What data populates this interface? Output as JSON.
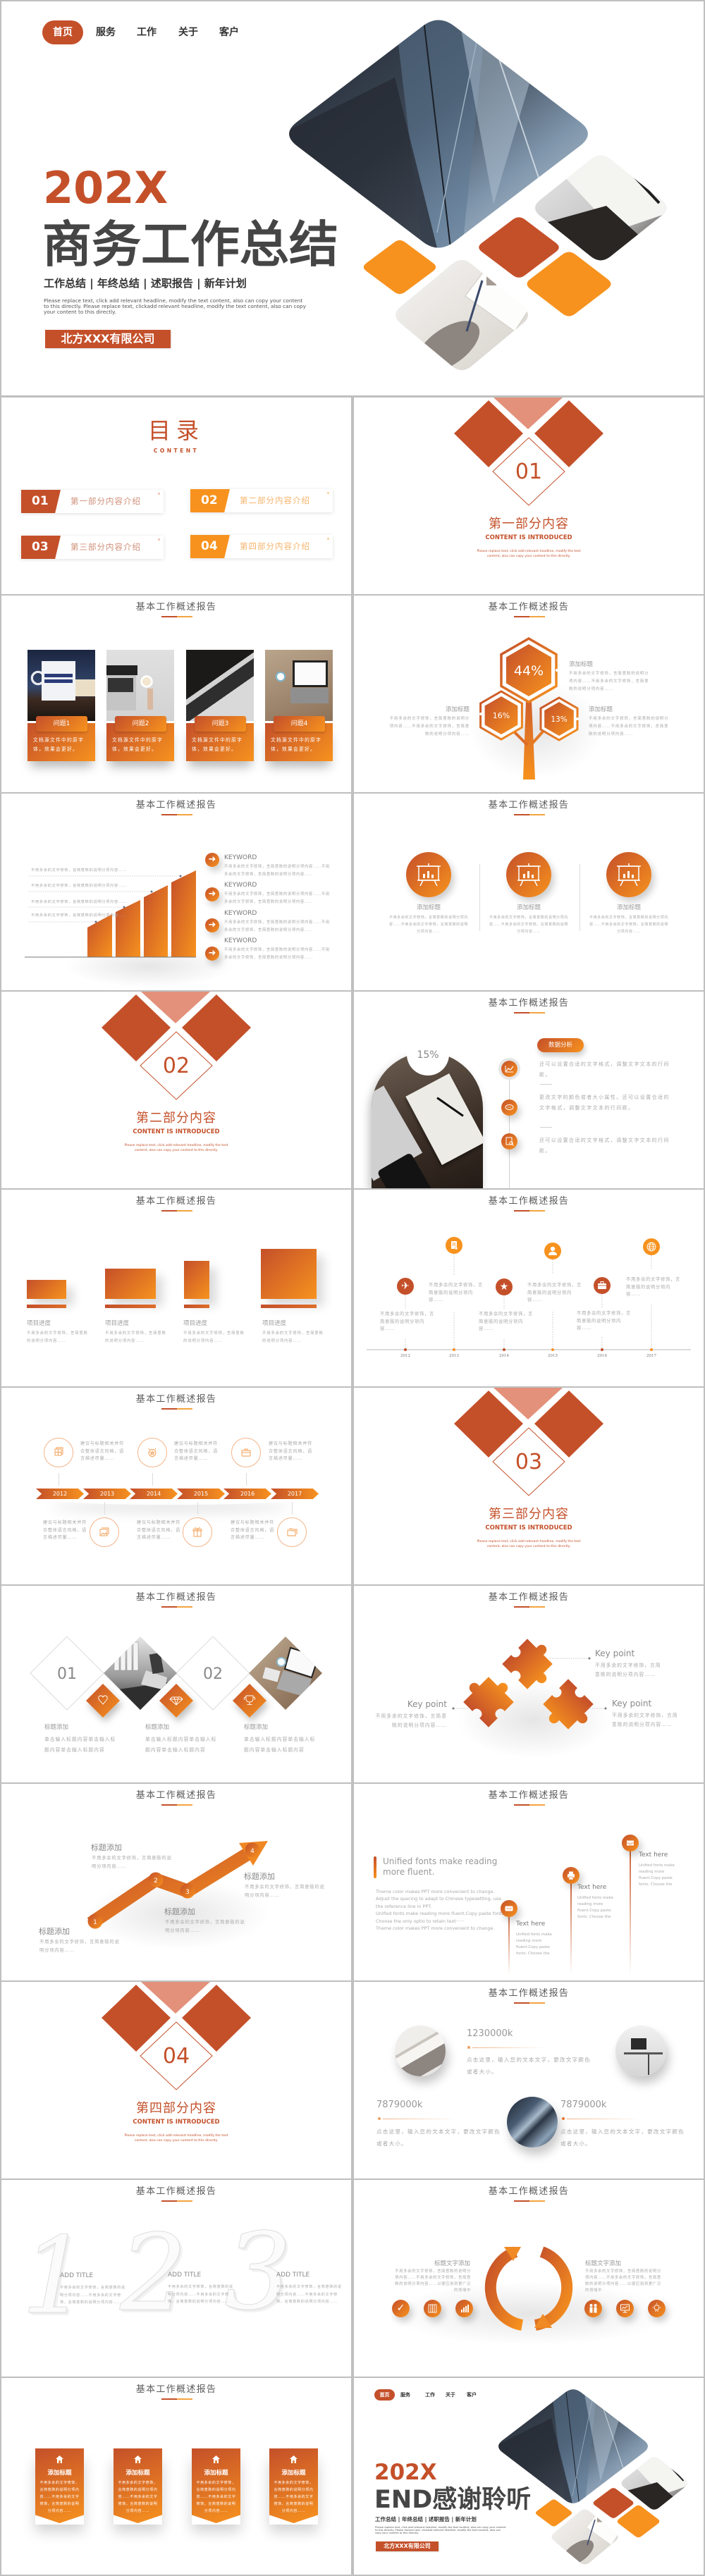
{
  "theme": {
    "primary": "#c4502a",
    "accent": "#f7921e",
    "light": "#e3917a"
  },
  "header_title": "基本工作概述报告",
  "cover": {
    "nav": [
      "首页",
      "服务",
      "工作",
      "关于",
      "客户"
    ],
    "active_nav": "首页",
    "year": "202X",
    "title": "商务工作总结",
    "subtitle": "工作总结 | 年终总结 | 述职报告 | 新年计划",
    "description": "Please replace text, click add relevant headline, modify the text content, also can copy your content to this directly. Please replace text, clickadd relevant headline, modify the text content, also can copy your content to this directly.",
    "company": "北方XXX有限公司"
  },
  "toc": {
    "title": "目录",
    "subtitle": "CONTENT",
    "items": [
      {
        "num": "01",
        "label": "第一部分内容介绍"
      },
      {
        "num": "02",
        "label": "第二部分内容介绍"
      },
      {
        "num": "03",
        "label": "第三部分内容介绍"
      },
      {
        "num": "04",
        "label": "第四部分内容介绍"
      }
    ]
  },
  "sections": [
    {
      "num": "01",
      "title": "第一部分内容",
      "subtitle": "CONTENT IS INTRODUCED",
      "description": "Please replace text, click add relevant headline, modify the text content, also can copy your content to this directly."
    },
    {
      "num": "02",
      "title": "第二部分内容",
      "subtitle": "CONTENT IS INTRODUCED",
      "description": "Please replace text, click add relevant headline, modify the text content, also can copy your content to this directly."
    },
    {
      "num": "03",
      "title": "第三部分内容",
      "subtitle": "CONTENT IS INTRODUCED",
      "description": "Please replace text, click add relevant headline, modify the text content, also can copy your content to this directly."
    },
    {
      "num": "04",
      "title": "第四部分内容",
      "subtitle": "CONTENT IS INTRODUCED",
      "description": "Please replace text, click add relevant headline, modify the text content, also can copy your content to this directly."
    }
  ],
  "problem_cards": {
    "items": [
      {
        "title": "问题1",
        "text": "文档源文件中的原字体，效果会更好。"
      },
      {
        "title": "问题2",
        "text": "文档源文件中的原字体，效果会更好。"
      },
      {
        "title": "问题3",
        "text": "文档源文件中的原字体，效果会更好。"
      },
      {
        "title": "问题4",
        "text": "文档源文件中的原字体，效果会更好。"
      }
    ]
  },
  "hex_tree": {
    "items": [
      {
        "value": "44%",
        "title": "添加标题",
        "text": "不用多余的文字修饰，言简意赅的说明分项内容……不用多余的文字修饰，言简意赅的说明分项内容……"
      },
      {
        "value": "16%",
        "title": "添加标题",
        "text": "不用多余的文字修饰，言简意赅的说明分项内容……不用多余的文字修饰，言简意赅的说明分项内容……"
      },
      {
        "value": "13%",
        "title": "添加标题",
        "text": "不用多余的文字修饰，言简意赅的说明分项内容……不用多余的文字修饰，言简意赅的说明分项内容……"
      }
    ]
  },
  "step_bars": {
    "notes": [
      "不用多余的文字修饰，言简意赅的说明分项内容……",
      "不用多余的文字修饰，言简意赅的说明分项内容……",
      "不用多余的文字修饰，言简意赅的说明分项内容……",
      "不用多余的文字修饰，言简意赅的说明分项内容……"
    ],
    "keywords": [
      {
        "title": "KEYWORD",
        "text": "不用多余的文字修饰，言简意赅的说明分项内容……不用多余的文字修饰，言简意赅的说明分项内容……"
      },
      {
        "title": "KEYWORD",
        "text": "不用多余的文字修饰，言简意赅的说明分项内容……不用多余的文字修饰，言简意赅的说明分项内容……"
      },
      {
        "title": "KEYWORD",
        "text": "不用多余的文字修饰，言简意赅的说明分项内容……不用多余的文字修饰，言简意赅的说明分项内容……"
      },
      {
        "title": "KEYWORD",
        "text": "不用多余的文字修饰，言简意赅的说明分项内容……不用多余的文字修饰，言简意赅的说明分项内容……"
      }
    ]
  },
  "three_circles": {
    "items": [
      {
        "title": "添加标题",
        "text": "不用多余的文字修饰，言简意赅的说明分项内容……不用多余的文字修饰，言简意赅的说明分项内容……"
      },
      {
        "title": "添加标题",
        "text": "不用多余的文字修饰，言简意赅的说明分项内容……不用多余的文字修饰，言简意赅的说明分项内容……"
      },
      {
        "title": "添加标题",
        "text": "不用多余的文字修饰，言简意赅的说明分项内容……不用多余的文字修饰，言简意赅的说明分项内容……"
      }
    ]
  },
  "data_analysis": {
    "percent": "15%",
    "tag": "数据分析",
    "items": [
      "还可以设置合适的文字格式，调整文字文本的行间距。",
      "更改文字的颜色或者大小属性。还可以设置合适的文字格式，调整文字文本的行间距。",
      "还可以设置合适的文字格式，调整文字文本的行间距。"
    ]
  },
  "progress": {
    "items": [
      {
        "title": "项目进度",
        "text": "不用多余的文字修饰，言简意赅的说明分项内容……"
      },
      {
        "title": "项目进度",
        "text": "不用多余的文字修饰，言简意赅的说明分项内容……"
      },
      {
        "title": "项目进度",
        "text": "不用多余的文字修饰，言简意赅的说明分项内容……"
      },
      {
        "title": "项目进度",
        "text": "不用多余的文字修饰，言简意赅的说明分项内容……"
      }
    ]
  },
  "year_timeline": {
    "items": [
      {
        "year": "2012",
        "icon": "airplane",
        "text": "不用多余的文字修饰，言简意赅的说明分项内容……"
      },
      {
        "year": "2013",
        "icon": "document",
        "text": "不用多余的文字修饰，言简意赅的说明分项内容……"
      },
      {
        "year": "2014",
        "icon": "star-badge",
        "text": "不用多余的文字修饰，言简意赅的说明分项内容……"
      },
      {
        "year": "2015",
        "icon": "person",
        "text": "不用多余的文字修饰，言简意赅的说明分项内容……"
      },
      {
        "year": "2016",
        "icon": "briefcase",
        "text": "不用多余的文字修饰，言简意赅的说明分项内容……"
      },
      {
        "year": "2017",
        "icon": "globe",
        "text": "不用多余的文字修饰，言简意赅的说明分项内容……"
      }
    ]
  },
  "chevron_timeline": {
    "items": [
      {
        "year": "2012",
        "icon": "window",
        "text": "建议与标题相关并符合整体语言风格，语言描述尽量……"
      },
      {
        "year": "2013",
        "icon": "image",
        "text": "建议与标题相关并符合整体语言风格，语言描述尽量……"
      },
      {
        "year": "2014",
        "icon": "badge",
        "text": "建议与标题相关并符合整体语言风格，语言描述尽量……"
      },
      {
        "year": "2015",
        "icon": "gift",
        "text": "建议与标题相关并符合整体语言风格，语言描述尽量……"
      },
      {
        "year": "2016",
        "icon": "briefcase",
        "text": "建议与标题相关并符合整体语言风格，语言描述尽量……"
      },
      {
        "year": "2017",
        "icon": "folders",
        "text": "建议与标题相关并符合整体语言风格，语言描述尽量……"
      }
    ]
  },
  "diamond_features": {
    "numbers": [
      "01",
      "02"
    ],
    "items": [
      {
        "title": "标题添加",
        "icon": "heart",
        "text": "单击输入标题内容单击输入标题内容单击输入标题内容"
      },
      {
        "title": "标题添加",
        "icon": "gem",
        "text": "单击输入标题内容单击输入标题内容单击输入标题内容"
      },
      {
        "title": "标题添加",
        "icon": "trophy",
        "text": "单击输入标题内容单击输入标题内容单击输入标题内容"
      }
    ]
  },
  "puzzle": {
    "items": [
      {
        "title": "Key point",
        "text": "不用多余的文字修饰，言简意赅的说明分项内容……"
      },
      {
        "title": "Key point",
        "text": "不用多余的文字修饰，言简意赅的说明分项内容……"
      },
      {
        "title": "Key point",
        "text": "不用多余的文字修饰，言简意赅的说明分项内容……"
      }
    ]
  },
  "growth_arrow": {
    "items": [
      {
        "num": "1",
        "title": "标题添加",
        "text": "不用多余的文字修饰，言简意赅的说明分项内容……"
      },
      {
        "num": "2",
        "title": "标题添加",
        "text": "不用多余的文字修饰，言简意赅的说明分项内容……"
      },
      {
        "num": "3",
        "title": "标题添加",
        "text": "不用多余的文字修饰，言简意赅的说明分项内容……"
      },
      {
        "num": "4",
        "title": "标题添加",
        "text": "不用多余的文字修饰，言简意赅的说明分项内容……"
      }
    ]
  },
  "unified_fonts": {
    "heading": "Unified fonts make reading more fluent.",
    "body": [
      "Theme color makes PPT more convenient to change.",
      "Adjust the spacing to adapt to Chinese typesetting, use the reference line in PPT.",
      "Unified fonts make reading more fluent.Copy paste fonts.",
      "Choose the only optio to retain text······",
      "Theme color makes PPT more convenient to change."
    ],
    "pins": [
      {
        "title": "Text here",
        "text": "Unified fonts make reading more fluent.Copy paste fonts. Choose the"
      },
      {
        "title": "Text here",
        "text": "Unified fonts make reading more fluent.Copy paste fonts. Choose the"
      },
      {
        "title": "Text here",
        "text": "Unified fonts make reading more fluent.Copy paste fonts. Choose the"
      }
    ]
  },
  "stats": {
    "items": [
      {
        "value": "1230000k",
        "text": "点击这里，输入您的文本文字，更改文字颜色或者大小。"
      },
      {
        "value": "7879000k",
        "text": "点击这里，输入您的文本文字，更改文字颜色或者大小。"
      },
      {
        "value": "7879000k",
        "text": "点击这里，输入您的文本文字，更改文字颜色或者大小。"
      }
    ]
  },
  "numbered": {
    "items": [
      {
        "num": "1",
        "title": "ADD TITLE",
        "text": "不用多余的文字修饰，言简意赅的说明分项内容……不用多余的文字修饰，言简意赅的说明分项内容……"
      },
      {
        "num": "2",
        "title": "ADD TITLE",
        "text": "不用多余的文字修饰，言简意赅的说明分项内容……不用多余的文字修饰，言简意赅的说明分项内容……"
      },
      {
        "num": "3",
        "title": "ADD TITLE",
        "text": "不用多余的文字修饰，言简意赅的说明分项内容……不用多余的文字修饰，言简意赅的说明分项内容……"
      }
    ]
  },
  "cycle": {
    "items": [
      {
        "title": "标题文字添加",
        "text": "不用多余的文字修饰，言简意赅的说明分项内容……不用多余的文字修饰，言简意赅的说明分项内容……以便应用到更广泛的领域中"
      },
      {
        "title": "标题文字添加",
        "text": "不用多余的文字修饰，言简意赅的说明分项内容……不用多余的文字修饰，言简意赅的说明分项内容……以便应用到更广泛的领域中"
      }
    ],
    "icons": [
      "check",
      "book",
      "bar-chart",
      "people",
      "monitor",
      "lightbulb"
    ]
  },
  "tags": {
    "items": [
      {
        "title": "添加标题",
        "text": "不用多余的文字修饰，言简意赅的说明分项内容……不用多余的文字修饰，言简意赅的说明分项内容……"
      },
      {
        "title": "添加标题",
        "text": "不用多余的文字修饰，言简意赅的说明分项内容……不用多余的文字修饰，言简意赅的说明分项内容……"
      },
      {
        "title": "添加标题",
        "text": "不用多余的文字修饰，言简意赅的说明分项内容……不用多余的文字修饰，言简意赅的说明分项内容……"
      },
      {
        "title": "添加标题",
        "text": "不用多余的文字修饰，言简意赅的说明分项内容……不用多余的文字修饰，言简意赅的说明分项内容……"
      }
    ]
  },
  "end": {
    "nav": [
      "首页",
      "服务",
      "工作",
      "关于",
      "客户"
    ],
    "year": "202X",
    "title": "END感谢聆听",
    "subtitle": "工作总结 | 年终总结 | 述职报告 | 新年计划",
    "description": "Please replace text, click add relevant headline, modify the text content, also can copy your content to this directly. Please replace text, clickadd relevant headline, modify the text content, also can copy your content to this directly.",
    "company": "北方XXX有限公司"
  }
}
